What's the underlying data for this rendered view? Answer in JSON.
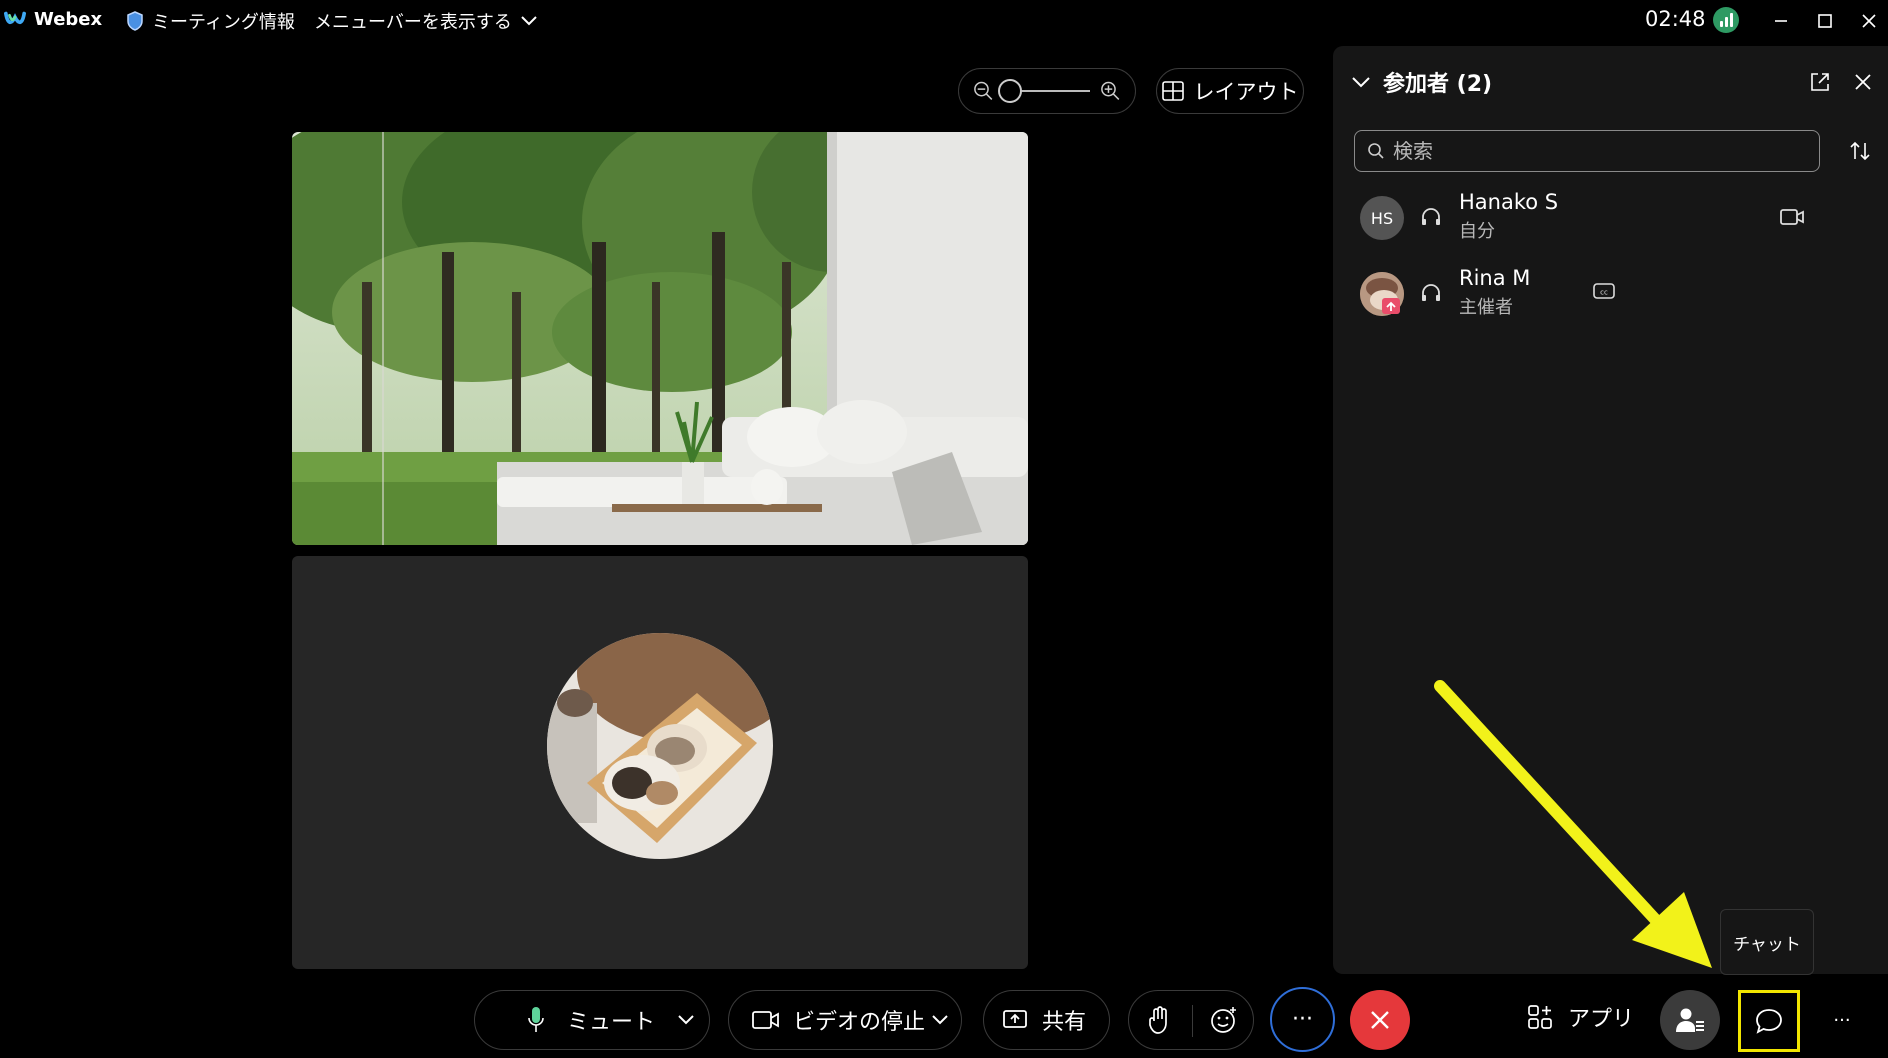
{
  "titlebar": {
    "app_name": "Webex",
    "meeting_info": "ミーティング情報",
    "menubar_toggle": "メニューバーを表示する",
    "clock": "02:48"
  },
  "stage": {
    "layout_label": "レイアウト"
  },
  "panel": {
    "title": "参加者 (2)",
    "search_placeholder": "検索",
    "participants": [
      {
        "initials": "HS",
        "name": "Hanako S",
        "role": "自分"
      },
      {
        "initials": "",
        "name": "Rina M",
        "role": "主催者"
      }
    ]
  },
  "tooltip": {
    "text": "チャット"
  },
  "bottombar": {
    "mute_label": "ミュート",
    "video_label": "ビデオの停止",
    "share_label": "共有",
    "more_label": "···",
    "apps_label": "アプリ",
    "overflow_label": "···"
  },
  "colors": {
    "end_call": "#e5383b",
    "highlight": "#f2e600",
    "accent_ring": "#2f6ed8",
    "panel_bg": "#161616",
    "tile_bg": "#262626"
  }
}
